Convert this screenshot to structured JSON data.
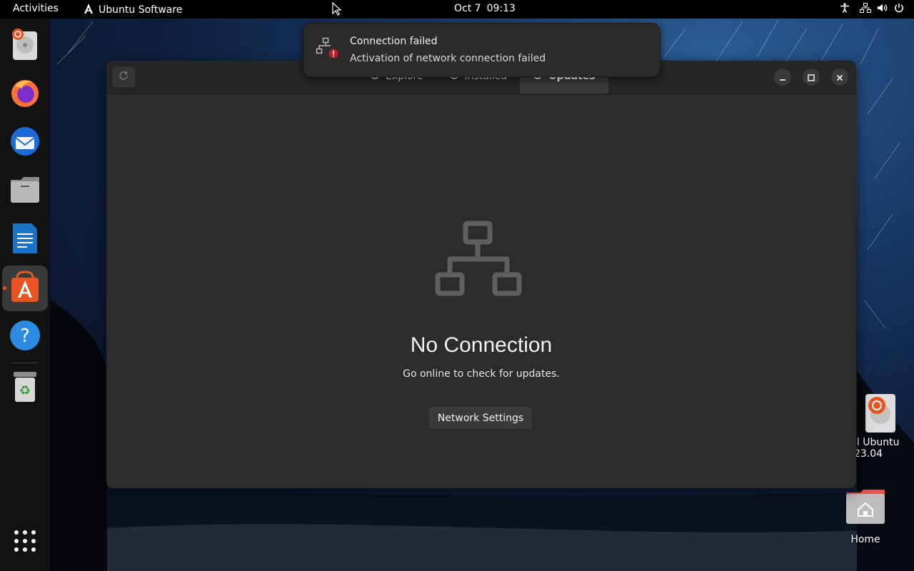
{
  "topbar": {
    "activities": "Activities",
    "app_name": "Ubuntu Software",
    "date": "Oct 7",
    "time": "09:13"
  },
  "dock": {
    "items": [
      "install-ubuntu",
      "firefox",
      "thunderbird",
      "files",
      "libreoffice-writer",
      "ubuntu-software",
      "help",
      "trash"
    ],
    "active": "ubuntu-software",
    "accent": "#e95420"
  },
  "notification": {
    "title": "Connection failed",
    "body": "Activation of network connection failed"
  },
  "window": {
    "tabs": [
      {
        "label": "Explore"
      },
      {
        "label": "Installed"
      },
      {
        "label": "Updates",
        "active": true
      }
    ],
    "empty_state": {
      "title": "No Connection",
      "subtitle": "Go online to check for updates.",
      "button": "Network Settings"
    }
  },
  "desktop": {
    "install_icon_label_1": "ll Ubuntu",
    "install_icon_label_2": "23.04",
    "home_label": "Home"
  }
}
